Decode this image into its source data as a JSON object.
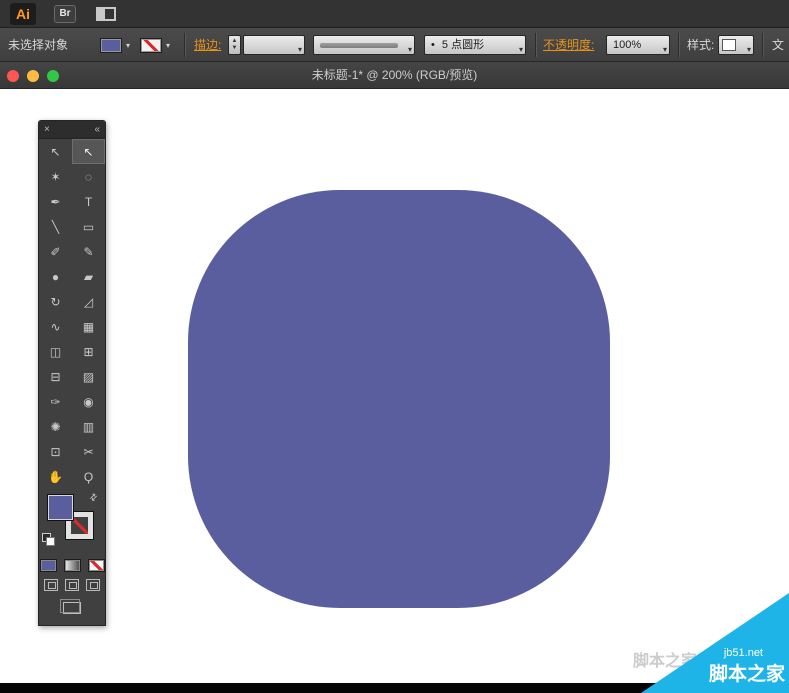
{
  "app_bar": {
    "logo": "Ai",
    "bridge_label": "Br"
  },
  "control_bar": {
    "selection_status": "未选择对象",
    "stroke_label": "描边:",
    "stroke_weight_value": "",
    "brush_bullet": "•",
    "brush_value": "5 点圆形",
    "opacity_label": "不透明度:",
    "opacity_value": "100%",
    "style_label": "样式:",
    "document_label": "文",
    "dropdown_arrow": "▾",
    "stepper_up": "▲",
    "stepper_down": "▼"
  },
  "window": {
    "title": "未标题-1* @ 200% (RGB/预览)"
  },
  "tools_panel": {
    "close_glyph": "×",
    "collapse_glyph": "«",
    "swap_glyph": "⇄",
    "tools": [
      {
        "name": "selection-tool",
        "glyph": "↖",
        "active": false
      },
      {
        "name": "direct-selection-tool",
        "glyph": "↖",
        "active": true
      },
      {
        "name": "magic-wand-tool",
        "glyph": "✶",
        "active": false
      },
      {
        "name": "lasso-tool",
        "glyph": "◌",
        "active": false
      },
      {
        "name": "pen-tool",
        "glyph": "✒",
        "active": false
      },
      {
        "name": "type-tool",
        "glyph": "T",
        "active": false
      },
      {
        "name": "line-segment-tool",
        "glyph": "╲",
        "active": false
      },
      {
        "name": "rectangle-tool",
        "glyph": "▭",
        "active": false
      },
      {
        "name": "paintbrush-tool",
        "glyph": "✐",
        "active": false
      },
      {
        "name": "pencil-tool",
        "glyph": "✎",
        "active": false
      },
      {
        "name": "blob-brush-tool",
        "glyph": "●",
        "active": false
      },
      {
        "name": "eraser-tool",
        "glyph": "▰",
        "active": false
      },
      {
        "name": "rotate-tool",
        "glyph": "↻",
        "active": false
      },
      {
        "name": "scale-tool",
        "glyph": "◿",
        "active": false
      },
      {
        "name": "width-tool",
        "glyph": "∿",
        "active": false
      },
      {
        "name": "free-transform-tool",
        "glyph": "▦",
        "active": false
      },
      {
        "name": "shape-builder-tool",
        "glyph": "◫",
        "active": false
      },
      {
        "name": "perspective-grid-tool",
        "glyph": "⊞",
        "active": false
      },
      {
        "name": "mesh-tool",
        "glyph": "⊟",
        "active": false
      },
      {
        "name": "gradient-tool",
        "glyph": "▨",
        "active": false
      },
      {
        "name": "eyedropper-tool",
        "glyph": "✑",
        "active": false
      },
      {
        "name": "blend-tool",
        "glyph": "◉",
        "active": false
      },
      {
        "name": "symbol-sprayer-tool",
        "glyph": "✺",
        "active": false
      },
      {
        "name": "column-graph-tool",
        "glyph": "▥",
        "active": false
      },
      {
        "name": "artboard-tool",
        "glyph": "⊡",
        "active": false
      },
      {
        "name": "slice-tool",
        "glyph": "✂",
        "active": false
      },
      {
        "name": "hand-tool",
        "glyph": "✋",
        "active": false
      },
      {
        "name": "zoom-tool",
        "glyph": "Ϙ",
        "active": false
      }
    ]
  },
  "colors": {
    "shape_fill": "#5a5e9f",
    "accent_orange": "#e8921c",
    "watermark_cyan": "#1fb4e8"
  },
  "watermark": {
    "site": "jb51.net",
    "brand": "脚本之家"
  }
}
